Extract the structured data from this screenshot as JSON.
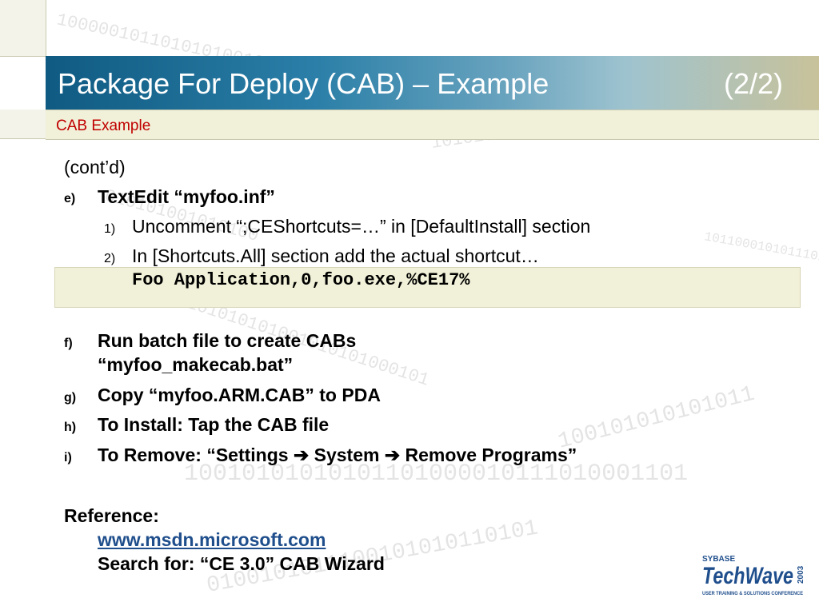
{
  "header": {
    "title": "Package For Deploy (CAB) – Example",
    "page": "(2/2)",
    "subtitle": "CAB Example"
  },
  "body": {
    "cont": "(cont’d)",
    "items": [
      {
        "label": "e)",
        "text": "TextEdit “myfoo.inf”"
      },
      {
        "label": "f)",
        "text": "Run batch file to create CABs",
        "text2": "“myfoo_makecab.bat”"
      },
      {
        "label": "g)",
        "text": "Copy “myfoo.ARM.CAB” to PDA"
      },
      {
        "label": "h)",
        "text": "To Install:  Tap the CAB file"
      },
      {
        "label": "i)",
        "text_a": "To Remove: “Settings ",
        "text_b": " System ",
        "text_c": " Remove Programs”",
        "arrow": "➔"
      }
    ],
    "subitems": [
      {
        "label": "1)",
        "text": "Uncomment “;CEShortcuts=…” in [DefaultInstall] section"
      },
      {
        "label": "2)",
        "text": "In [Shortcuts.All] section add the actual shortcut…"
      }
    ],
    "code": "Foo Application,0,foo.exe,%CE17%"
  },
  "reference": {
    "heading": "Reference:",
    "link": "www.msdn.microsoft.com",
    "search": "Search for:  “CE 3.0”  CAB Wizard"
  },
  "logo": {
    "brand": "SYBASE",
    "name": "TechWave",
    "year": "2003",
    "tagline": "USER TRAINING & SOLUTIONS CONFERENCE"
  },
  "colors": {
    "title_gradient_start": "#0f5a82",
    "subtitle_red": "#c00000",
    "code_bg": "#f1f0d8",
    "link_blue": "#1f4e8c"
  }
}
